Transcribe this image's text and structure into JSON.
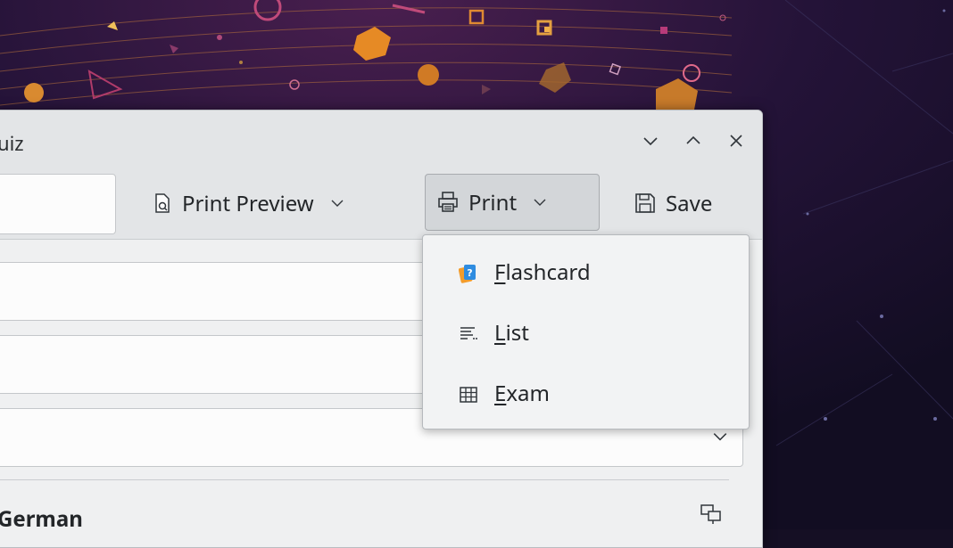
{
  "window": {
    "title": "uiz",
    "minimize_glyph": "chevron-down-icon",
    "maximize_glyph": "chevron-up-icon",
    "close_glyph": "close-icon"
  },
  "toolbar": {
    "print_preview_label": "Print Preview",
    "print_label": "Print",
    "save_label": "Save"
  },
  "print_menu": {
    "items": [
      {
        "mnemonic": "F",
        "rest": "lashcard",
        "icon": "flashcard-icon"
      },
      {
        "mnemonic": "L",
        "rest": "ist",
        "icon": "list-icon"
      },
      {
        "mnemonic": "E",
        "rest": "xam",
        "icon": "table-grid-icon"
      }
    ]
  },
  "form": {
    "section_title": "German"
  },
  "colors": {
    "wallpaper_bg": "#150f24",
    "window_bg": "#eff0f1",
    "titlebar_bg": "#e3e5e7",
    "active_button_bg": "#d3d6d9",
    "accent_orange": "#f39c2b"
  }
}
